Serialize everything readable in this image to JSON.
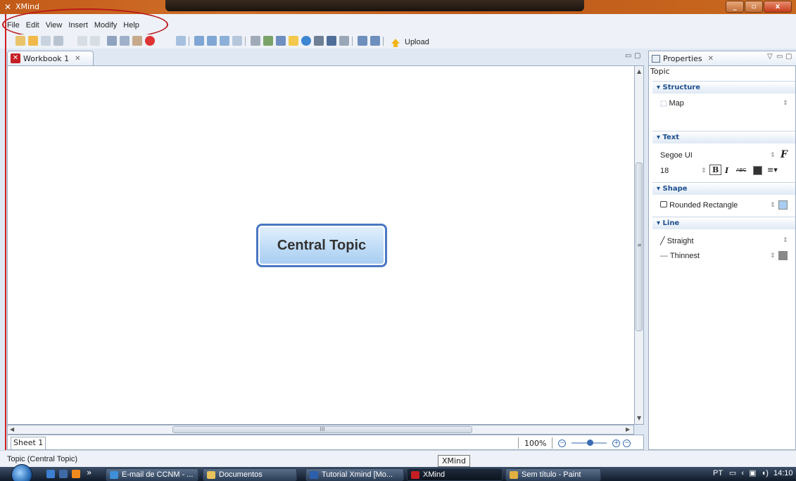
{
  "window": {
    "title": "XMind",
    "minimize": "_",
    "maximize": "▫",
    "close": "x"
  },
  "menu": [
    "File",
    "Edit",
    "View",
    "Insert",
    "Modify",
    "Help"
  ],
  "toolbar": {
    "upload_label": "Upload"
  },
  "editor": {
    "tab_label": "Workbook 1",
    "tab_close": "✕",
    "central_topic": "Central Topic",
    "hscroll_grip": "III",
    "vscroll_grip": "≡"
  },
  "sheets": {
    "tab": "Sheet 1",
    "zoom": "100%"
  },
  "properties": {
    "tab_label": "Properties",
    "tab_close": "✕",
    "subject": "Topic",
    "structure": {
      "header": "Structure",
      "value": "Map"
    },
    "text": {
      "header": "Text",
      "font": "Segoe UI",
      "size": "18",
      "bold": "B",
      "italic": "I",
      "strike": "ABC"
    },
    "shape": {
      "header": "Shape",
      "value": "Rounded Rectangle"
    },
    "line": {
      "header": "Line",
      "style": "Straight",
      "width": "Thinnest"
    }
  },
  "status": {
    "text": "Topic (Central Topic)",
    "tooltip": "XMind"
  },
  "taskbar": {
    "items": [
      "E-mail de CCNM - ...",
      "Documentos",
      "Tutorial Xmind [Mo...",
      "XMind",
      "Sem título - Paint"
    ],
    "overflow": "»",
    "lang": "PT",
    "clock": "14:10"
  },
  "colors": {
    "accent": "#4a78c2",
    "annotation": "#b81919",
    "brand": "#c51f24"
  }
}
